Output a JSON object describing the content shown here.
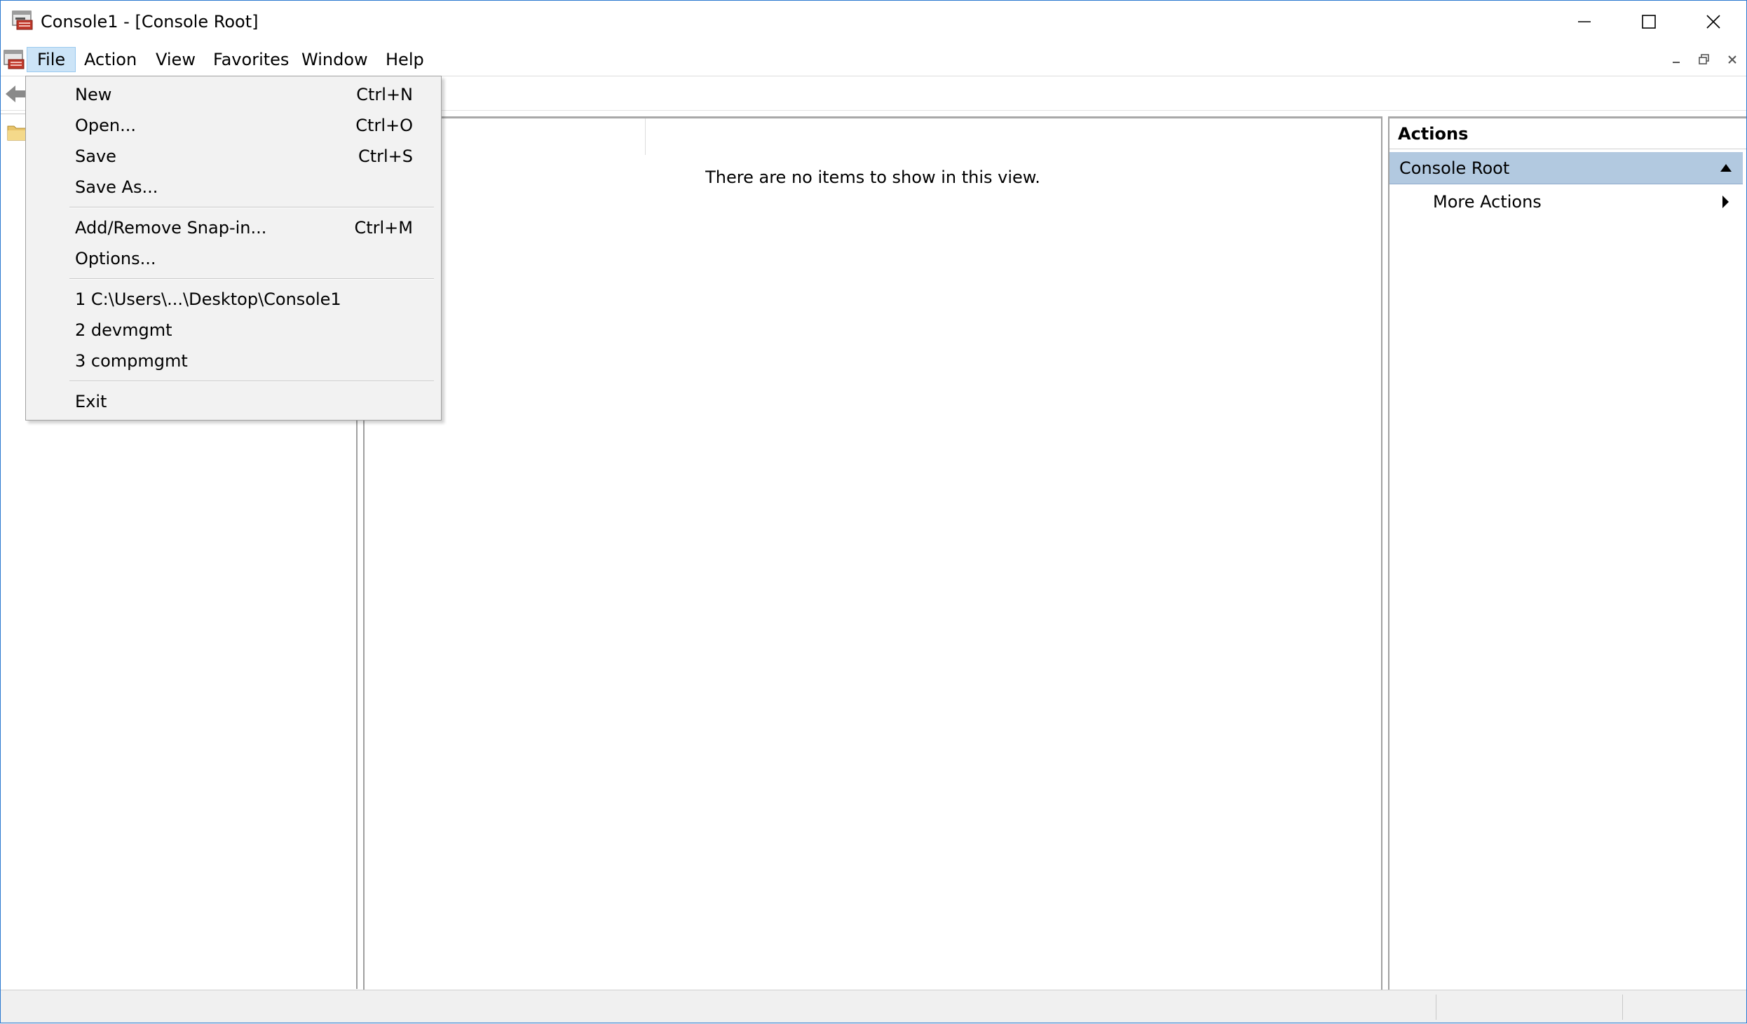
{
  "window": {
    "title": "Console1 - [Console Root]"
  },
  "menubar": {
    "items": [
      {
        "label": "File",
        "active": true
      },
      {
        "label": "Action"
      },
      {
        "label": "View"
      },
      {
        "label": "Favorites"
      },
      {
        "label": "Window"
      },
      {
        "label": "Help"
      }
    ]
  },
  "file_menu": {
    "items": [
      {
        "label": "New",
        "shortcut": "Ctrl+N"
      },
      {
        "label": "Open...",
        "shortcut": "Ctrl+O"
      },
      {
        "label": "Save",
        "shortcut": "Ctrl+S"
      },
      {
        "label": "Save As...",
        "shortcut": ""
      },
      {
        "label": "Add/Remove Snap-in...",
        "shortcut": "Ctrl+M"
      },
      {
        "label": "Options...",
        "shortcut": ""
      },
      {
        "label": "1 C:\\Users\\...\\Desktop\\Console1",
        "shortcut": ""
      },
      {
        "label": "2 devmgmt",
        "shortcut": ""
      },
      {
        "label": "3 compmgmt",
        "shortcut": ""
      },
      {
        "label": "Exit",
        "shortcut": ""
      }
    ]
  },
  "list": {
    "empty_message": "There are no items to show in this view."
  },
  "actions": {
    "header": "Actions",
    "section": "Console Root",
    "more_actions": "More Actions"
  },
  "colors": {
    "menu_active_bg": "#cce4f7",
    "section_bg": "#b2c9e0",
    "window_border": "#2b79d0"
  }
}
